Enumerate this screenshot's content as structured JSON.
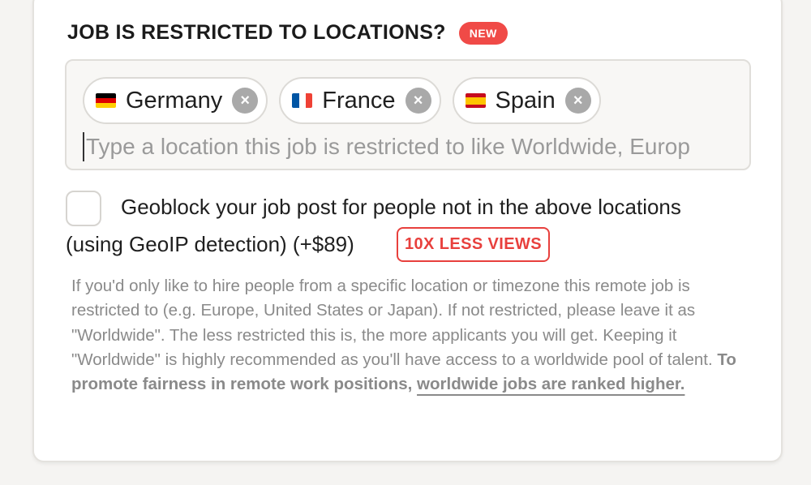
{
  "section": {
    "title": "JOB IS RESTRICTED TO LOCATIONS?",
    "badge": "NEW"
  },
  "locations": {
    "chips": [
      {
        "label": "Germany",
        "flag": "germany-flag-icon",
        "remove_icon": "×"
      },
      {
        "label": "France",
        "flag": "france-flag-icon",
        "remove_icon": "×"
      },
      {
        "label": "Spain",
        "flag": "spain-flag-icon",
        "remove_icon": "×"
      }
    ],
    "input_value": "",
    "placeholder": "Type a location this job is restricted to like Worldwide, Europ"
  },
  "geoblock": {
    "checked": false,
    "label_line1": "Geoblock your job post for people not in the above locations",
    "label_line2": "(using GeoIP detection) (+$89)",
    "warning_badge": "10X LESS VIEWS"
  },
  "help": {
    "text": "If you'd only like to hire people from a specific location or timezone this remote job is restricted to (e.g. Europe, United States or Japan). If not restricted, please leave it as \"Worldwide\". The less restricted this is, the more applicants you will get. Keeping it \"Worldwide\" is highly recommended as you'll have access to a worldwide pool of talent.",
    "bold_part1": "To promote fairness in remote work positions,",
    "bold_part2": "worldwide jobs are ranked higher."
  },
  "colors": {
    "accent_red": "#f04a47",
    "warning_red": "#e8403d",
    "help_text": "#8a8a8a"
  }
}
